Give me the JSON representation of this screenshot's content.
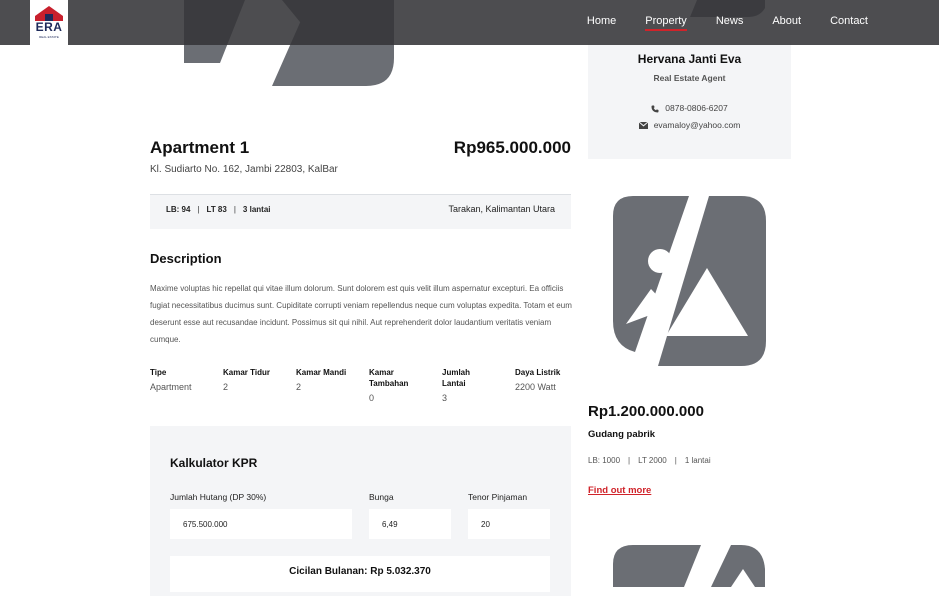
{
  "header": {
    "logo_text": "ERA",
    "logo_sub": "REAL ESTATE",
    "nav": [
      {
        "label": "Home"
      },
      {
        "label": "Property",
        "active": true
      },
      {
        "label": "News"
      },
      {
        "label": "About"
      },
      {
        "label": "Contact"
      }
    ],
    "accent_color": "#d0232a"
  },
  "listing": {
    "title": "Apartment 1",
    "price": "Rp965.000.000",
    "address": "Kl. Sudiarto No. 162, Jambi 22803, KalBar",
    "specs": [
      "LB: 94",
      "LT 83",
      "3 lantai"
    ],
    "separator": "|",
    "location": "Tarakan, Kalimantan Utara",
    "description_title": "Description",
    "description": "Maxime voluptas hic repellat qui vitae illum dolorum. Sunt dolorem est quis velit illum aspernatur excepturi. Ea officiis fugiat necessitatibus ducimus sunt. Cupiditate corrupti veniam repellendus neque cum voluptas expedita. Totam et eum deserunt esse aut recusandae incidunt. Possimus sit qui nihil. Aut reprehenderit dolor laudantium veritatis veniam cumque.",
    "features": [
      {
        "label": "Tipe",
        "value": "Apartment"
      },
      {
        "label": "Kamar Tidur",
        "value": "2"
      },
      {
        "label": "Kamar Mandi",
        "value": "2"
      },
      {
        "label": "Kamar Tambahan",
        "value": "0"
      },
      {
        "label": "Jumlah Lantai",
        "value": "3"
      },
      {
        "label": "Daya Listrik",
        "value": "2200 Watt"
      }
    ]
  },
  "calculator": {
    "title": "Kalkulator KPR",
    "debt_label": "Jumlah Hutang (DP 30%)",
    "debt_value": "675.500.000",
    "interest_label": "Bunga",
    "interest_value": "6,49",
    "tenor_label": "Tenor Pinjaman",
    "tenor_value": "20",
    "result": "Cicilan Bulanan: Rp 5.032.370"
  },
  "agent": {
    "name": "Hervana Janti Eva",
    "role": "Real Estate Agent",
    "phone": "0878-0806-6207",
    "email": "evamaloy@yahoo.com",
    "phone_icon": "phone-icon",
    "email_icon": "envelope-icon"
  },
  "related": {
    "price": "Rp1.200.000.000",
    "name": "Gudang pabrik",
    "specs": [
      "LB: 1000",
      "LT 2000",
      "1 lantai"
    ],
    "link": "Find out more"
  },
  "placeholder_color": "#6b6e74"
}
